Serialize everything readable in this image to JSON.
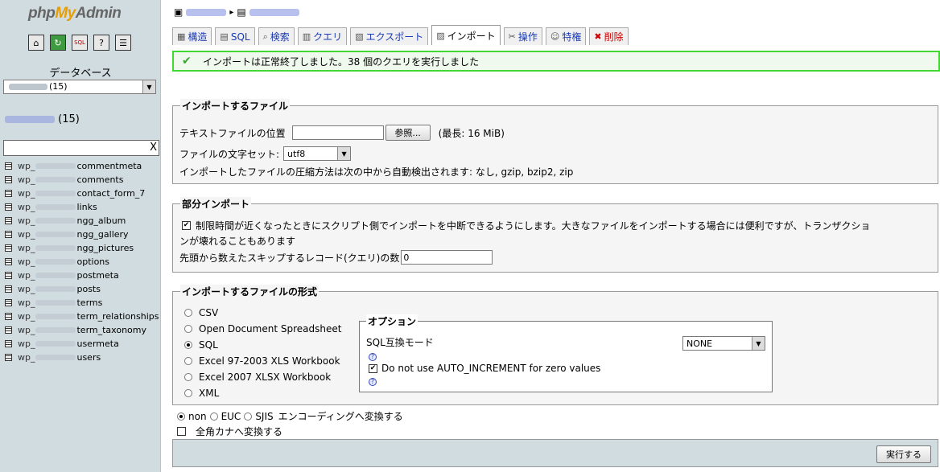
{
  "sidebar": {
    "logo": {
      "php": "php",
      "my": "My",
      "admin": "Admin"
    },
    "icons": [
      "home-icon",
      "reload-icon",
      "sql-icon",
      "docs-icon",
      "help-icon"
    ],
    "database_label": "データベース",
    "database_select_count": "(15)",
    "current_db_count": "(15)",
    "filter_value": "",
    "filter_clear": "X",
    "tables": [
      {
        "prefix": "wp_",
        "suffix": "commentmeta"
      },
      {
        "prefix": "wp_",
        "suffix": "comments"
      },
      {
        "prefix": "wp_",
        "suffix": "contact_form_7"
      },
      {
        "prefix": "wp_",
        "suffix": "links"
      },
      {
        "prefix": "wp_",
        "suffix": "ngg_album"
      },
      {
        "prefix": "wp_",
        "suffix": "ngg_gallery"
      },
      {
        "prefix": "wp_",
        "suffix": "ngg_pictures"
      },
      {
        "prefix": "wp_",
        "suffix": "options"
      },
      {
        "prefix": "wp_",
        "suffix": "postmeta"
      },
      {
        "prefix": "wp_",
        "suffix": "posts"
      },
      {
        "prefix": "wp_",
        "suffix": "terms"
      },
      {
        "prefix": "wp_",
        "suffix": "term_relationships"
      },
      {
        "prefix": "wp_",
        "suffix": "term_taxonomy"
      },
      {
        "prefix": "wp_",
        "suffix": "usermeta"
      },
      {
        "prefix": "wp_",
        "suffix": "users"
      }
    ]
  },
  "breadcrumb": {
    "separator": "▸"
  },
  "tabs": [
    {
      "label": "構造",
      "icon": "structure-icon",
      "glyph": "▦"
    },
    {
      "label": "SQL",
      "icon": "sql-icon",
      "glyph": "▤"
    },
    {
      "label": "検索",
      "icon": "search-icon",
      "glyph": "⌕"
    },
    {
      "label": "クエリ",
      "icon": "query-icon",
      "glyph": "▥"
    },
    {
      "label": "エクスポート",
      "icon": "export-icon",
      "glyph": "▧"
    },
    {
      "label": "インポート",
      "icon": "import-icon",
      "glyph": "▨"
    },
    {
      "label": "操作",
      "icon": "tools-icon",
      "glyph": "✂"
    },
    {
      "label": "特権",
      "icon": "privileges-icon",
      "glyph": "☺"
    },
    {
      "label": "削除",
      "icon": "delete-icon",
      "glyph": "✖"
    }
  ],
  "active_tab": "インポート",
  "success_message": "インポートは正常終了しました。38 個のクエリを実行しました",
  "import_file": {
    "legend": "インポートするファイル",
    "location_label": "テキストファイルの位置",
    "browse_button": "参照...",
    "max_size": "(最長: 16 MiB)",
    "charset_label": "ファイルの文字セット:",
    "charset_value": "utf8",
    "compression_note": "インポートしたファイルの圧縮方法は次の中から自動検出されます: なし, gzip, bzip2, zip"
  },
  "partial_import": {
    "legend": "部分インポート",
    "allow_interrupt_line1": "制限時間が近くなったときにスクリプト側でインポートを中断できるようにします。大きなファイルをインポートする場合には便利ですが、トランザクショ",
    "allow_interrupt_line2": "ンが壊れることもあります",
    "allow_interrupt_checked": true,
    "skip_label": "先頭から数えたスキップするレコード(クエリ)の数",
    "skip_value": "0"
  },
  "format": {
    "legend": "インポートするファイルの形式",
    "options": [
      "CSV",
      "Open Document Spreadsheet",
      "SQL",
      "Excel 97-2003 XLS Workbook",
      "Excel 2007 XLSX Workbook",
      "XML"
    ],
    "selected": "SQL",
    "sub_options": {
      "legend": "オプション",
      "compat_label": "SQL互換モード",
      "compat_value": "NONE",
      "help_glyph": "?",
      "no_auto_increment_label": "Do not use AUTO_INCREMENT for zero values",
      "no_auto_increment_checked": true
    }
  },
  "encoding": {
    "options": [
      "non",
      "EUC",
      "SJIS"
    ],
    "selected": "non",
    "suffix": "エンコーディングへ変換する",
    "kana_label": "全角カナへ変換する",
    "kana_checked": false
  },
  "submit_button": "実行する"
}
